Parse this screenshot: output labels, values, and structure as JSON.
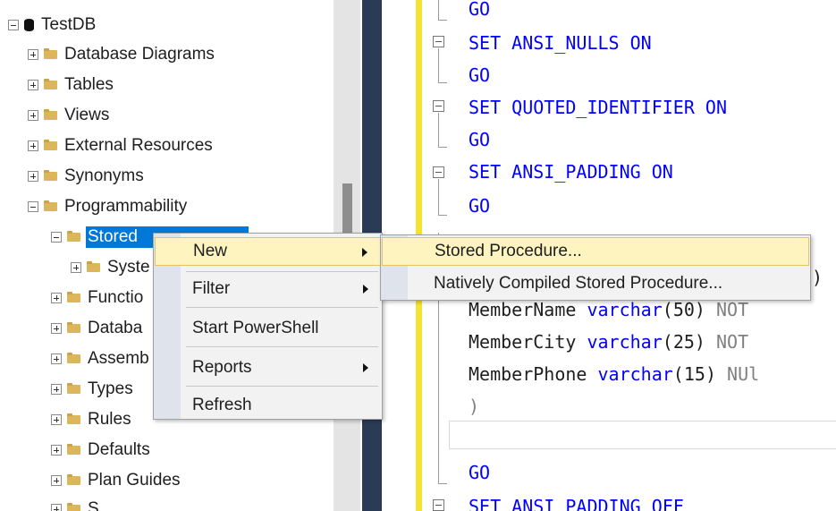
{
  "tree": {
    "root": "TestDB",
    "items": [
      {
        "label": "Database Diagrams"
      },
      {
        "label": "Tables"
      },
      {
        "label": "Views"
      },
      {
        "label": "External Resources"
      },
      {
        "label": "Synonyms"
      },
      {
        "label": "Programmability"
      },
      {
        "label": "Stored"
      },
      {
        "label": "Syste"
      },
      {
        "label": "Functio"
      },
      {
        "label": "Databa"
      },
      {
        "label": "Assemb"
      },
      {
        "label": "Types"
      },
      {
        "label": "Rules"
      },
      {
        "label": "Defaults"
      },
      {
        "label": "Plan Guides"
      },
      {
        "label": "S"
      }
    ]
  },
  "code": {
    "go1": "GO",
    "ansi_nulls": "SET ANSI_NULLS ON",
    "go2": "GO",
    "quoted_ident": "SET QUOTED_IDENTIFIER ON",
    "go3": "GO",
    "ansi_padding": "SET ANSI_PADDING ON",
    "go4": "GO",
    "paren_tail": ")",
    "member_name_col": "MemberName",
    "member_name_type": "varchar",
    "member_name_len": "50",
    "member_name_rest": "NOT",
    "member_city_col": "MemberCity",
    "member_city_type": "varchar",
    "member_city_len": "25",
    "member_city_rest": "NOT",
    "member_phone_col": "MemberPhone",
    "member_phone_type": "varchar",
    "member_phone_len": "15",
    "member_phone_rest": "NUl",
    "close_paren": ")",
    "go5": "GO",
    "ansi_padding_off": "SET ANSI PADDING OFF"
  },
  "context_menu": {
    "items": [
      {
        "label": "New"
      },
      {
        "label": "Filter"
      },
      {
        "label": "Start PowerShell"
      },
      {
        "label": "Reports"
      },
      {
        "label": "Refresh"
      }
    ]
  },
  "submenu": {
    "items": [
      {
        "label": "Stored Procedure..."
      },
      {
        "label": "Natively Compiled Stored Procedure..."
      }
    ]
  },
  "colors": {
    "selection": "#0078d7",
    "keyword": "#0000ff",
    "menu_highlight": "#fdf4bf",
    "change_bar": "#f6e232"
  }
}
